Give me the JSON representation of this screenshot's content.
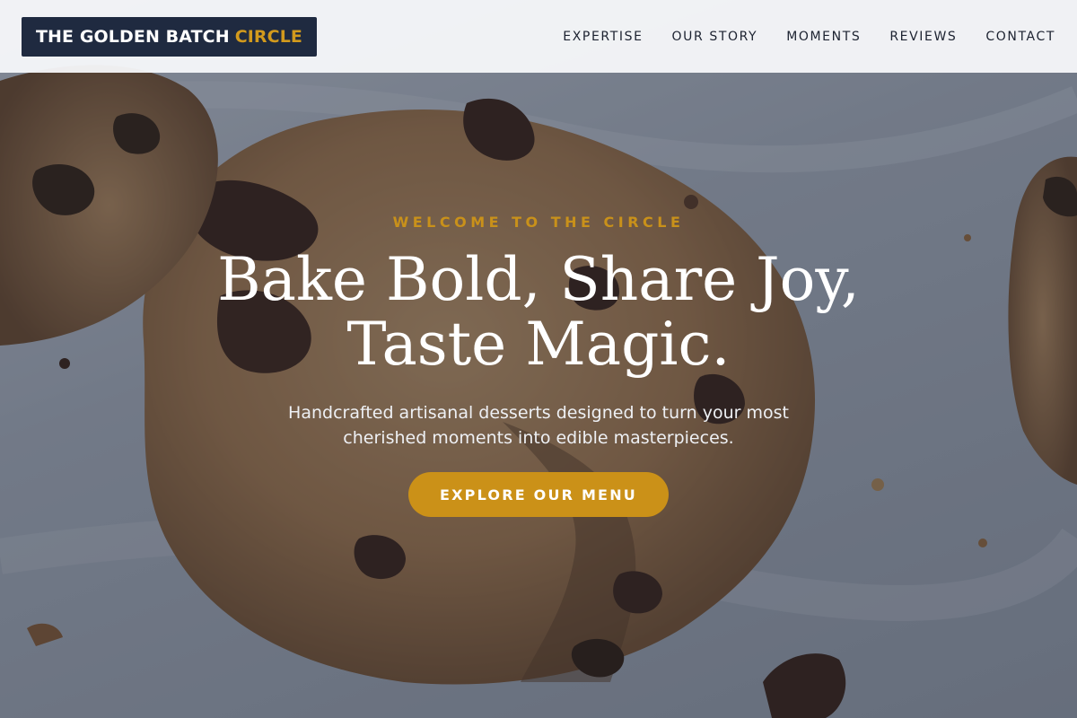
{
  "brand": {
    "name_main": "THE GOLDEN BATCH",
    "name_accent": "CIRCLE",
    "accent_color": "#d29a1d",
    "logo_bg": "#1f2a40"
  },
  "nav": {
    "items": [
      {
        "label": "EXPERTISE"
      },
      {
        "label": "OUR STORY"
      },
      {
        "label": "MOMENTS"
      },
      {
        "label": "REVIEWS"
      },
      {
        "label": "CONTACT"
      }
    ]
  },
  "hero": {
    "eyebrow": "WELCOME TO THE CIRCLE",
    "headline_line1": "Bake Bold, Share Joy,",
    "headline_line2": "Taste Magic.",
    "subtitle": "Handcrafted artisanal desserts designed to turn your most cherished moments into edible masterpieces.",
    "cta_label": "EXPLORE OUR MENU",
    "cta_color": "#cb9118",
    "background_image": "chocolate-chip-cookies-photo"
  }
}
